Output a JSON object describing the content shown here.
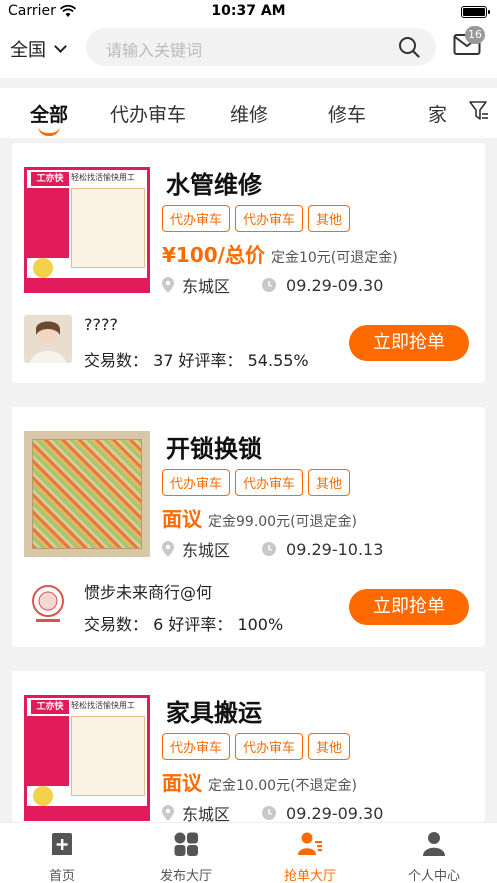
{
  "status_bar": {
    "carrier": "Carrier",
    "time": "10:37 AM"
  },
  "header": {
    "region": "全国",
    "search_placeholder": "请输入关键词",
    "message_count": "16"
  },
  "tabs": [
    {
      "label": "全部",
      "active": true
    },
    {
      "label": "代办审车",
      "active": false
    },
    {
      "label": "维修",
      "active": false
    },
    {
      "label": "修车",
      "active": false
    },
    {
      "label": "家",
      "active": false
    }
  ],
  "colors": {
    "accent": "#ff6a00",
    "background": "#f2f2f2"
  },
  "poster": {
    "tag": "工亦快",
    "headline": "轻松找活愉快用工"
  },
  "orders": [
    {
      "title": "水管维修",
      "tags": [
        "代办审车",
        "代办审车",
        "其他"
      ],
      "price": "¥100/总价",
      "deposit": "定金10元(可退定金)",
      "district": "东城区",
      "date_range": "09.29-09.30",
      "user_name": "????",
      "stats": "交易数：  37  好评率：  54.55%",
      "grab_label": "立即抢单"
    },
    {
      "title": "开锁换锁",
      "tags": [
        "代办审车",
        "代办审车",
        "其他"
      ],
      "price": "面议",
      "deposit": "定金99.00元(可退定金)",
      "district": "东城区",
      "date_range": "09.29-10.13",
      "user_name": "惯步未来商行@何",
      "stats": "交易数：  6   好评率：  100%",
      "grab_label": "立即抢单"
    },
    {
      "title": "家具搬运",
      "tags": [
        "代办审车",
        "代办审车",
        "其他"
      ],
      "price": "面议",
      "deposit": "定金10.00元(不退定金)",
      "district": "东城区",
      "date_range": "09.29-09.30"
    }
  ],
  "bottom_nav": [
    {
      "label": "首页",
      "icon": "home-plus-icon",
      "active": false
    },
    {
      "label": "发布大厅",
      "icon": "grid-icon",
      "active": false
    },
    {
      "label": "抢单大厅",
      "icon": "grab-orders-icon",
      "active": true
    },
    {
      "label": "个人中心",
      "icon": "person-icon",
      "active": false
    }
  ]
}
